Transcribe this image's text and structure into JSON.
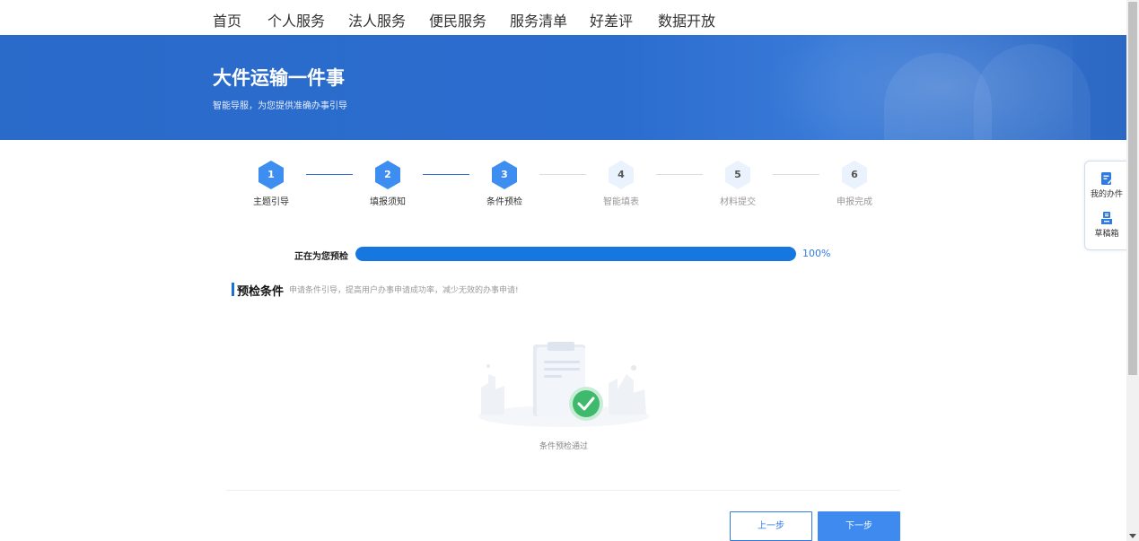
{
  "nav": {
    "items": [
      {
        "label": "首页"
      },
      {
        "label": "个人服务"
      },
      {
        "label": "法人服务"
      },
      {
        "label": "便民服务"
      },
      {
        "label": "服务清单"
      },
      {
        "label": "好差评"
      },
      {
        "label": "数据开放"
      }
    ]
  },
  "banner": {
    "title": "大件运输一件事",
    "subtitle": "智能导服，为您提供准确办事引导"
  },
  "steps": [
    {
      "number": "1",
      "label": "主题引导",
      "state": "done"
    },
    {
      "number": "2",
      "label": "填报须知",
      "state": "done"
    },
    {
      "number": "3",
      "label": "条件预检",
      "state": "current"
    },
    {
      "number": "4",
      "label": "智能填表",
      "state": "todo"
    },
    {
      "number": "5",
      "label": "材料提交",
      "state": "todo"
    },
    {
      "number": "6",
      "label": "申报完成",
      "state": "todo"
    }
  ],
  "progress": {
    "label": "正在为您预检",
    "value": 100,
    "value_text": "100%"
  },
  "section": {
    "title": "预检条件",
    "description": "申请条件引导，提高用户办事申请成功率，减少无效的办事申请!"
  },
  "result": {
    "caption": "条件预检通过"
  },
  "buttons": {
    "prev": "上一步",
    "next": "下一步"
  },
  "side_panel": {
    "my_items": "我的办件",
    "drafts": "草稿箱"
  },
  "colors": {
    "primary": "#1677e0",
    "banner": "#2b6dcf",
    "step_active": "#3d8ef0",
    "step_inactive": "#eaf2fd",
    "success": "#3fb96b"
  }
}
